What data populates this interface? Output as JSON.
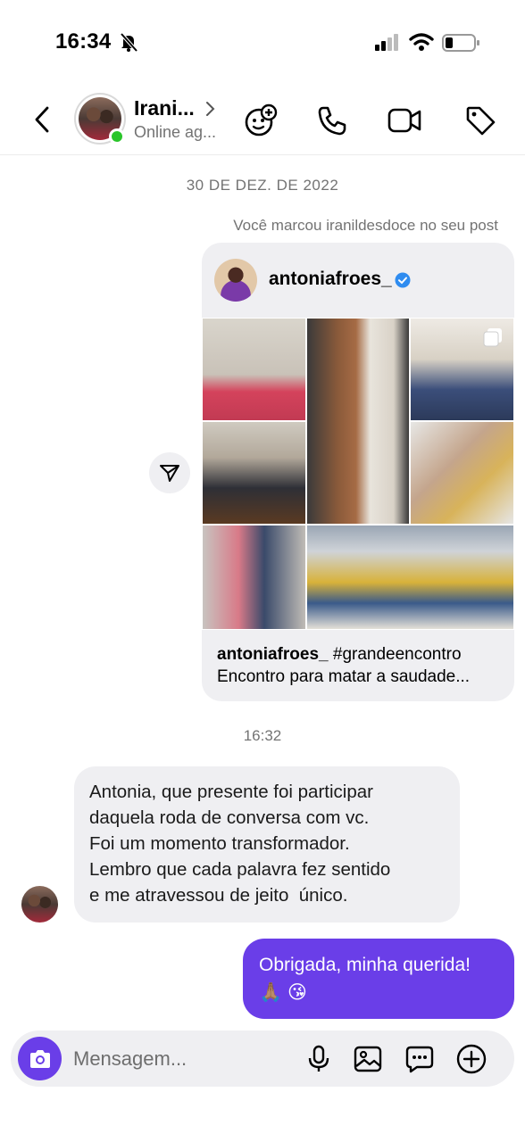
{
  "status_bar": {
    "time": "16:34",
    "icons": [
      "bell-slash-icon",
      "signal-icon",
      "wifi-icon",
      "battery-icon"
    ]
  },
  "header": {
    "contact_name": "Irani...",
    "contact_status": "Online ag...",
    "online_color": "#2ac52a",
    "actions": [
      "add-effect-icon",
      "phone-icon",
      "video-icon",
      "tag-icon"
    ]
  },
  "chat": {
    "date_label": "30 DE DEZ. DE 2022",
    "marked_note": "Você marcou iranildesdoce no seu post",
    "post": {
      "username": "antoniafroes_",
      "caption_tag": "#grandeencontro",
      "caption_text": "Encontro para matar a saudade..."
    },
    "time_label": "16:32",
    "incoming_message": {
      "lines": [
        "Antonia, que presente foi participar",
        "daquela roda de conversa com vc.",
        "Foi um momento transformador.",
        "Lembro que cada palavra fez sentido",
        "e me atravessou de jeito  único."
      ]
    },
    "outgoing_message": {
      "line1": "Obrigada, minha querida!",
      "line2": "🙏🏽 😘"
    }
  },
  "composer": {
    "placeholder": "Mensagem...",
    "accent": "#6a3ee8"
  }
}
